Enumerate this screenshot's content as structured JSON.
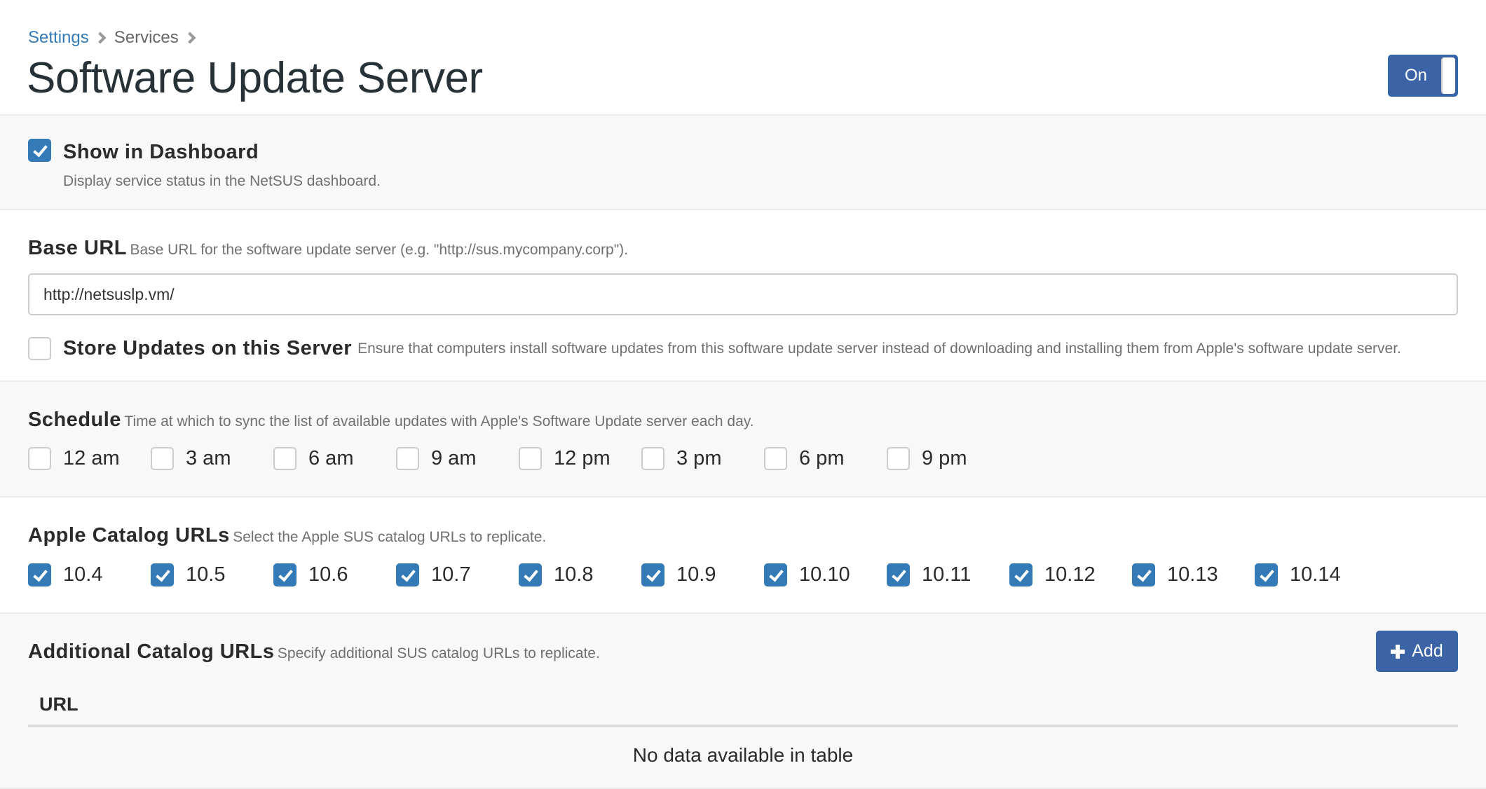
{
  "breadcrumb": [
    {
      "label": "Settings",
      "link": true
    },
    {
      "label": "Services",
      "link": false
    }
  ],
  "page_title": "Software Update Server",
  "service_toggle": {
    "label": "On",
    "state": "on"
  },
  "show_in_dashboard": {
    "label": "Show in Dashboard",
    "help": "Display service status in the NetSUS dashboard.",
    "checked": true
  },
  "base_url": {
    "label": "Base URL",
    "help": "Base URL for the software update server (e.g. \"http://sus.mycompany.corp\").",
    "value": "http://netsuslp.vm/"
  },
  "store_updates": {
    "label": "Store Updates on this Server",
    "help": "Ensure that computers install software updates from this software update server instead of downloading and installing them from Apple's software update server.",
    "checked": false
  },
  "schedule": {
    "label": "Schedule",
    "help": "Time at which to sync the list of available updates with Apple's Software Update server each day.",
    "options": [
      {
        "label": "12 am",
        "checked": false
      },
      {
        "label": "3 am",
        "checked": false
      },
      {
        "label": "6 am",
        "checked": false
      },
      {
        "label": "9 am",
        "checked": false
      },
      {
        "label": "12 pm",
        "checked": false
      },
      {
        "label": "3 pm",
        "checked": false
      },
      {
        "label": "6 pm",
        "checked": false
      },
      {
        "label": "9 pm",
        "checked": false
      }
    ]
  },
  "apple_catalogs": {
    "label": "Apple Catalog URLs",
    "help": "Select the Apple SUS catalog URLs to replicate.",
    "options": [
      {
        "label": "10.4",
        "checked": true
      },
      {
        "label": "10.5",
        "checked": true
      },
      {
        "label": "10.6",
        "checked": true
      },
      {
        "label": "10.7",
        "checked": true
      },
      {
        "label": "10.8",
        "checked": true
      },
      {
        "label": "10.9",
        "checked": true
      },
      {
        "label": "10.10",
        "checked": true
      },
      {
        "label": "10.11",
        "checked": true
      },
      {
        "label": "10.12",
        "checked": true
      },
      {
        "label": "10.13",
        "checked": true
      },
      {
        "label": "10.14",
        "checked": true
      }
    ]
  },
  "additional_catalogs": {
    "label": "Additional Catalog URLs",
    "help": "Specify additional SUS catalog URLs to replicate.",
    "add_button": "Add",
    "table": {
      "columns": [
        "URL"
      ],
      "rows": [],
      "empty_message": "No data available in table"
    }
  },
  "colors": {
    "primary": "#3b63a6",
    "checkbox_checked": "#337ab7",
    "link": "#337ab7",
    "section_gray": "#f8f8f8"
  }
}
